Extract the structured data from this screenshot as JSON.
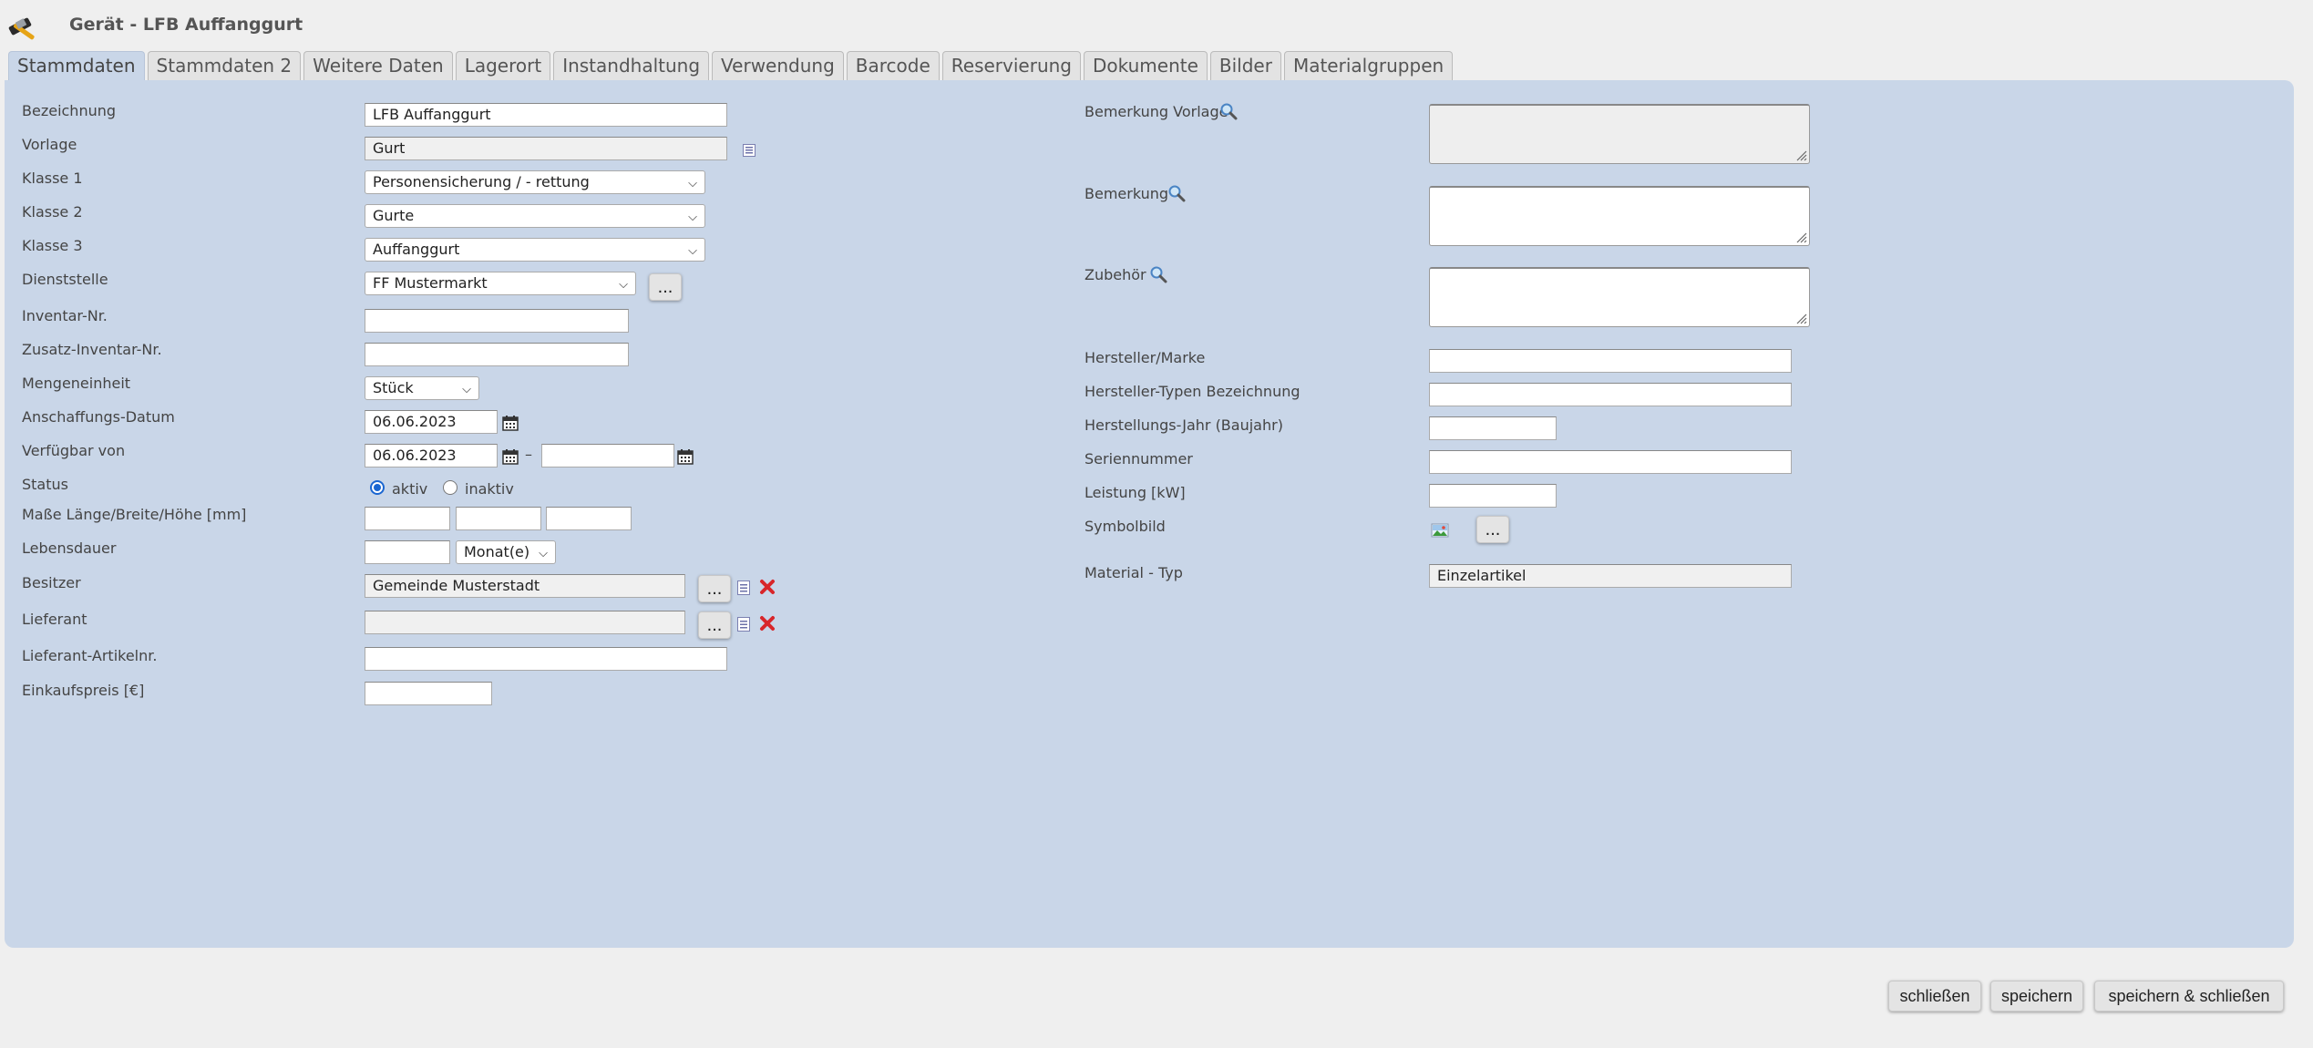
{
  "window": {
    "title": "Gerät - LFB Auffanggurt",
    "icon": "hammer-icon"
  },
  "tabs": [
    {
      "label": "Stammdaten",
      "active": true
    },
    {
      "label": "Stammdaten 2"
    },
    {
      "label": "Weitere Daten"
    },
    {
      "label": "Lagerort"
    },
    {
      "label": "Instandhaltung"
    },
    {
      "label": "Verwendung"
    },
    {
      "label": "Barcode"
    },
    {
      "label": "Reservierung"
    },
    {
      "label": "Dokumente"
    },
    {
      "label": "Bilder"
    },
    {
      "label": "Materialgruppen"
    }
  ],
  "left": {
    "bezeichnung": {
      "label": "Bezeichnung",
      "value": "LFB Auffanggurt"
    },
    "vorlage": {
      "label": "Vorlage",
      "value": "Gurt"
    },
    "klasse1": {
      "label": "Klasse 1",
      "value": "Personensicherung / - rettung"
    },
    "klasse2": {
      "label": "Klasse 2",
      "value": "Gurte"
    },
    "klasse3": {
      "label": "Klasse 3",
      "value": "Auffanggurt"
    },
    "dienststelle": {
      "label": "Dienststelle",
      "value": "FF Mustermarkt"
    },
    "inventar": {
      "label": "Inventar-Nr.",
      "value": ""
    },
    "zusatz_inventar": {
      "label": "Zusatz-Inventar-Nr.",
      "value": ""
    },
    "mengeneinheit": {
      "label": "Mengeneinheit",
      "value": "Stück"
    },
    "anschaffung": {
      "label": "Anschaffungs-Datum",
      "value": "06.06.2023"
    },
    "verfuegbar": {
      "label": "Verfügbar von",
      "from": "06.06.2023",
      "to": "",
      "separator": "–"
    },
    "status": {
      "label": "Status",
      "options": [
        "aktiv",
        "inaktiv"
      ],
      "selected": "aktiv"
    },
    "masse": {
      "label": "Maße Länge/Breite/Höhe [mm]",
      "laenge": "",
      "breite": "",
      "hoehe": ""
    },
    "lebensdauer": {
      "label": "Lebensdauer",
      "value": "",
      "unit": "Monat(e)"
    },
    "besitzer": {
      "label": "Besitzer",
      "value": "Gemeinde Musterstadt"
    },
    "lieferant": {
      "label": "Lieferant",
      "value": ""
    },
    "lieferant_artikel": {
      "label": "Lieferant-Artikelnr.",
      "value": ""
    },
    "einkaufspreis": {
      "label": "Einkaufspreis [€]",
      "value": ""
    }
  },
  "right": {
    "bemerkung_vorlage": {
      "label": "Bemerkung Vorlage",
      "value": ""
    },
    "bemerkung": {
      "label": "Bemerkung",
      "value": ""
    },
    "zubehoer": {
      "label": "Zubehör",
      "value": ""
    },
    "hersteller": {
      "label": "Hersteller/Marke",
      "value": ""
    },
    "hersteller_typ": {
      "label": "Hersteller-Typen Bezeichnung",
      "value": ""
    },
    "herstellungsjahr": {
      "label": "Herstellungs-Jahr (Baujahr)",
      "value": ""
    },
    "seriennummer": {
      "label": "Seriennummer",
      "value": ""
    },
    "leistung": {
      "label": "Leistung [kW]",
      "value": ""
    },
    "symbolbild": {
      "label": "Symbolbild"
    },
    "material_typ": {
      "label": "Material - Typ",
      "value": "Einzelartikel"
    }
  },
  "common": {
    "ellipsis": "..."
  },
  "footer": {
    "close": "schließen",
    "save": "speichern",
    "save_close": "speichern & schließen"
  },
  "colors": {
    "panel": "#c9d6e8",
    "delete_red": "#d8262a",
    "radio_blue": "#1a66d1"
  }
}
